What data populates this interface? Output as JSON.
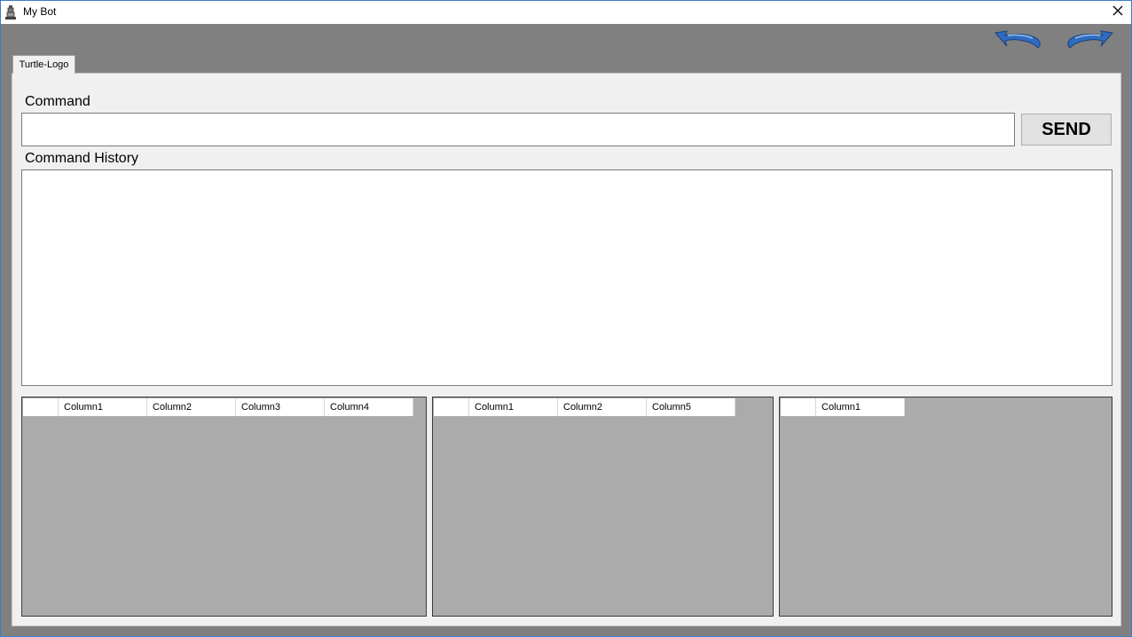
{
  "window": {
    "title": "My Bot"
  },
  "toolbar": {
    "undo_icon": "undo-arrow-icon",
    "redo_icon": "redo-arrow-icon"
  },
  "tabs": [
    {
      "label": "Turtle-Logo"
    }
  ],
  "command": {
    "label": "Command",
    "value": "",
    "send_label": "SEND"
  },
  "history": {
    "label": "Command History"
  },
  "grids": [
    {
      "columns": [
        "Column1",
        "Column2",
        "Column3",
        "Column4"
      ]
    },
    {
      "columns": [
        "Column1",
        "Column2",
        "Column5"
      ]
    },
    {
      "columns": [
        "Column1"
      ]
    }
  ],
  "colors": {
    "window_border": "#3b7fc4",
    "chrome_gray": "#808080",
    "panel_bg": "#f0f0f0",
    "grid_bg": "#ababab",
    "arrow_blue": "#2f6cc0"
  }
}
